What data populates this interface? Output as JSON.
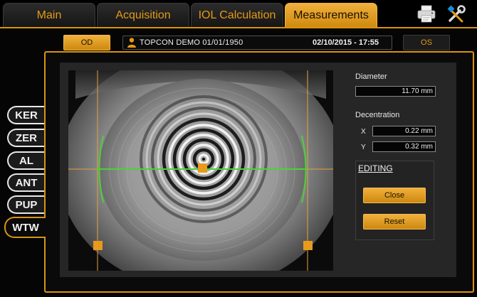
{
  "tabs": [
    {
      "label": "Main",
      "active": false
    },
    {
      "label": "Acquisition",
      "active": false
    },
    {
      "label": "IOL Calculation",
      "active": false
    },
    {
      "label": "Measurements",
      "active": true
    }
  ],
  "toolbar": {
    "print_icon": "printer-icon",
    "settings_icon": "tools-icon"
  },
  "eye_selector": {
    "od_label": "OD",
    "os_label": "OS",
    "selected": "OD"
  },
  "patient": {
    "icon": "person-icon",
    "name": "TOPCON DEMO 01/01/1950",
    "exam_datetime": "02/10/2015 - 17:55"
  },
  "side_tabs": [
    {
      "label": "KER",
      "active": false
    },
    {
      "label": "ZER",
      "active": false
    },
    {
      "label": "AL",
      "active": false
    },
    {
      "label": "ANT",
      "active": false
    },
    {
      "label": "PUP",
      "active": false
    },
    {
      "label": "WTW",
      "active": true
    }
  ],
  "measurements": {
    "diameter_label": "Diameter",
    "diameter_value": "11.70 mm",
    "decentration_label": "Decentration",
    "x_label": "X",
    "x_value": "0.22 mm",
    "y_label": "Y",
    "y_value": "0.32 mm"
  },
  "editing": {
    "title": "EDITING",
    "close_label": "Close",
    "reset_label": "Reset"
  },
  "colors": {
    "accent": "#d9940f",
    "overlay_line": "#e6a040",
    "wtw_arc": "#4bd13a",
    "handle": "#e89a1c"
  }
}
